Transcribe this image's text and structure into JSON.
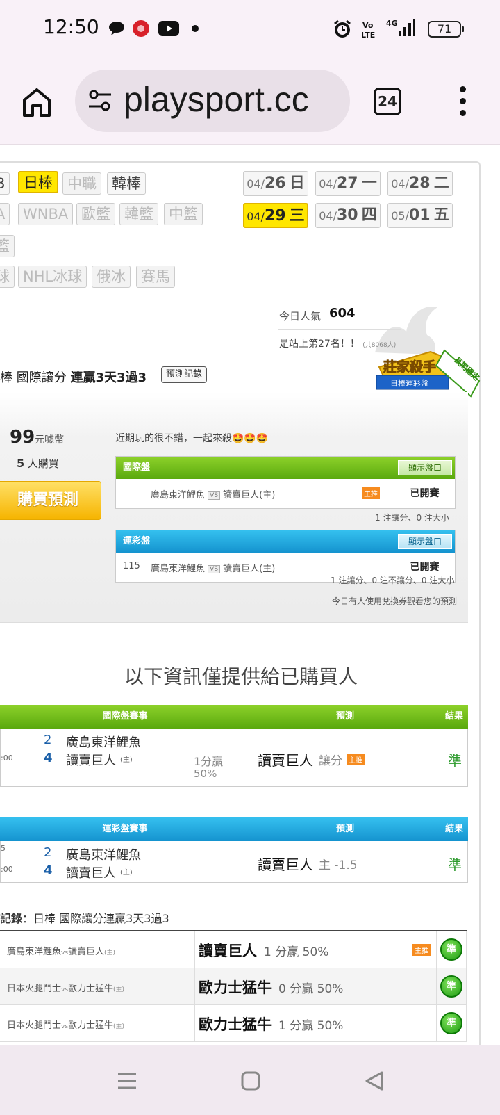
{
  "status_bar": {
    "time": "12:50",
    "battery": "71"
  },
  "browser": {
    "url": "playsport.cc",
    "tab_count": "24"
  },
  "sport_tags": {
    "row1": [
      "B",
      "日棒",
      "中職",
      "韓棒"
    ],
    "row2": [
      "A",
      "WNBA",
      "歐籃",
      "韓籃",
      "中籃"
    ],
    "row3": [
      "籃"
    ],
    "row4": [
      "球",
      "NHL冰球",
      "俄冰",
      "賽馬"
    ]
  },
  "dates": [
    {
      "md": "04/",
      "d": "26",
      "w": "日"
    },
    {
      "md": "04/",
      "d": "27",
      "w": "一"
    },
    {
      "md": "04/",
      "d": "28",
      "w": "二"
    },
    {
      "md": "04/",
      "d": "29",
      "w": "三"
    },
    {
      "md": "04/",
      "d": "30",
      "w": "四"
    },
    {
      "md": "05/",
      "d": "01",
      "w": "五"
    }
  ],
  "popularity": {
    "label": "今日人氣",
    "value": "604",
    "rank": "是站上第27名！！",
    "rank_total": "(共8068人)"
  },
  "prediction": {
    "title_prefix": "棒 國際讓分 ",
    "title_bold": "連贏3天3過3",
    "record_btn": "預測記錄",
    "badge_main": "莊家殺手",
    "badge_sub": "日棒運彩盤",
    "badge_ribbon": "長期穩定",
    "price": "99",
    "price_unit": "元噱幣",
    "buyers": "5",
    "buyers_unit": "人購買",
    "buy_btn": "購買預測",
    "comment": "近期玩的很不錯，一起來殺🤩🤩🤩"
  },
  "board_intl": {
    "title": "國際盤",
    "show_btn": "顯示盤口",
    "num": "",
    "away": "廣島東洋鯉魚",
    "vs": "VS",
    "home": "讀賣巨人(主)",
    "tag": "主推",
    "status": "已開賽",
    "note": "1 注讓分、0 注大小"
  },
  "board_sport": {
    "title": "運彩盤",
    "show_btn": "顯示盤口",
    "num": "115",
    "away": "廣島東洋鯉魚",
    "vs": "VS",
    "home": "讀賣巨人(主)",
    "status": "已開賽",
    "note": "1 注讓分、0 注不讓分、0 注大小",
    "note2": "今日有人使用兌換券觀看您的預測"
  },
  "buyers_banner": "以下資訊僅提供給已購買人",
  "result_intl": {
    "col_game": "國際盤賽事",
    "col_pred": "預測",
    "col_result": "結果",
    "time": ":00",
    "score_away": "2",
    "team_away": "廣島東洋鯉魚",
    "score_home": "4",
    "team_home": "讀賣巨人",
    "home_mark": "(主)",
    "line": "1分贏",
    "line_pct": "50%",
    "pick": "讀賣巨人",
    "pick_type": "讓分",
    "pick_tag": "主推",
    "result": "準"
  },
  "result_sport": {
    "col_game": "運彩盤賽事",
    "col_pred": "預測",
    "col_result": "結果",
    "num_tail": "5",
    "time": ":00",
    "score_away": "2",
    "team_away": "廣島東洋鯉魚",
    "score_home": "4",
    "team_home": "讀賣巨人",
    "home_mark": "(主)",
    "pick": "讀賣巨人",
    "pick_type": "主 -1.5",
    "result": "準"
  },
  "record": {
    "title_bold": "記錄",
    "title_rest": "：日棒 國際讓分連贏3天3過3",
    "rows": [
      {
        "away": "廣島東洋鯉魚",
        "vs": "vs",
        "home": "讀賣巨人",
        "mark": "(主)",
        "pick": "讀賣巨人",
        "line": "1 分贏 50%",
        "tag": "主推",
        "result": "準"
      },
      {
        "away": "日本火腿鬥士",
        "vs": "vs",
        "home": "歐力士猛牛",
        "mark": "(主)",
        "pick": "歐力士猛牛",
        "line": "0 分贏 50%",
        "tag": "",
        "result": "準"
      },
      {
        "away": "日本火腿鬥士",
        "vs": "vs",
        "home": "歐力士猛牛",
        "mark": "(主)",
        "pick": "歐力士猛牛",
        "line": "1 分贏 50%",
        "tag": "",
        "result": "準"
      }
    ]
  }
}
